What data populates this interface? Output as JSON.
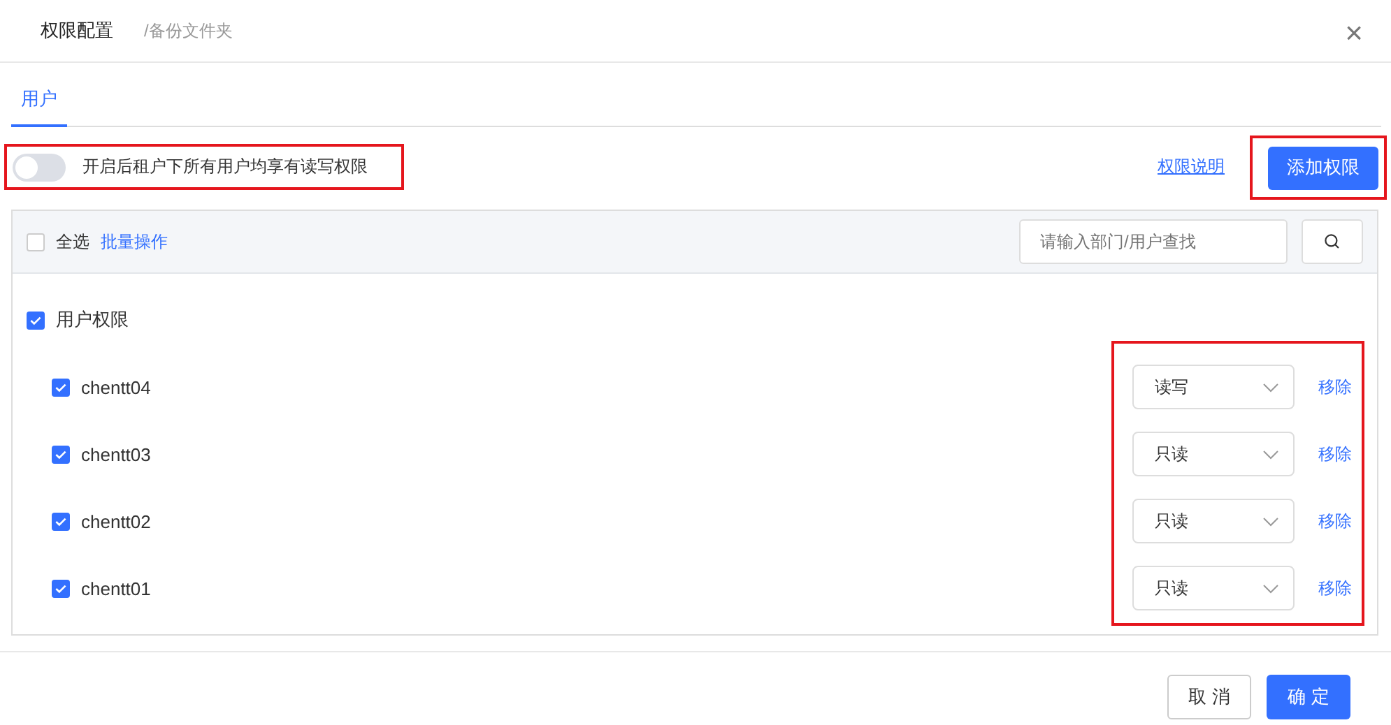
{
  "dialog": {
    "title": "权限配置",
    "path": "/备份文件夹",
    "close": "×"
  },
  "tabs": [
    {
      "label": "用户",
      "selected": true
    }
  ],
  "toolbar": {
    "toggle": {
      "on": false,
      "label": "开启后租户下所有用户均享有读写权限",
      "highlighted": true
    },
    "help_link": "权限说明",
    "add_button": {
      "label": "添加权限",
      "highlighted": true
    }
  },
  "panel": {
    "select_all": {
      "label": "全选",
      "checked": false
    },
    "batch_link": "批量操作",
    "search": {
      "placeholder": "请输入部门/用户查找"
    },
    "tree": {
      "label": "用户权限",
      "checked": true,
      "controls_highlighted": true,
      "children": [
        {
          "name": "chentt04",
          "checked": true,
          "permission": "读写",
          "remove": "移除"
        },
        {
          "name": "chentt03",
          "checked": true,
          "permission": "只读",
          "remove": "移除"
        },
        {
          "name": "chentt02",
          "checked": true,
          "permission": "只读",
          "remove": "移除"
        },
        {
          "name": "chentt01",
          "checked": true,
          "permission": "只读",
          "remove": "移除"
        }
      ]
    }
  },
  "footer": {
    "buttons": [
      {
        "label": "取 消",
        "kind": "secondary"
      },
      {
        "label": "确 定",
        "kind": "primary"
      }
    ]
  }
}
